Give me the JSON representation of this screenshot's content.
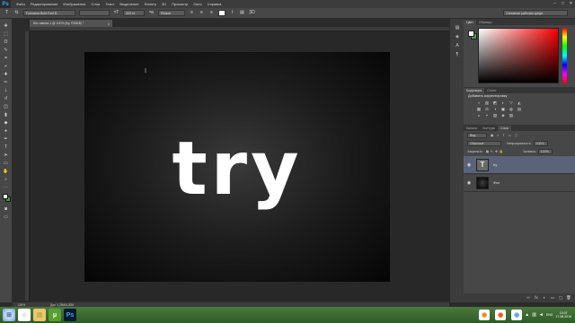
{
  "app": {
    "logo": "Ps",
    "menu": [
      "Файл",
      "Редактирование",
      "Изображение",
      "Слои",
      "Текст",
      "Выделение",
      "Фильтр",
      "3D",
      "Просмотр",
      "Окно",
      "Справка"
    ],
    "window_controls": [
      "–",
      "□",
      "✕"
    ]
  },
  "options": {
    "font_family": "Futurama Bold Font R...",
    "font_style": "",
    "font_size": "300 пт",
    "antialias": "Резкое",
    "workspace": "Основная рабочая среда"
  },
  "document": {
    "tab_title": "Без имени-1 @ 100% (try, RGB/8) *",
    "tab_close": "×",
    "canvas_text": "try",
    "cursor_glyph": "I"
  },
  "status": {
    "zoom": "100%",
    "doc_info": "Док: 3,25М/5,20М"
  },
  "panels": {
    "color_tabs": [
      "Цвет",
      "Образцы"
    ],
    "adjustments_tabs": [
      "Коррекция",
      "Стили"
    ],
    "adjustments_title": "Добавить корректировку",
    "adjustments_row1": [
      "☼",
      "▥",
      "◩",
      "◐",
      "▽",
      "◭"
    ],
    "adjustments_row2": [
      "▦",
      "⚖",
      "◑",
      "▣",
      "◍",
      "▤"
    ],
    "adjustments_row3": [
      "◒",
      "◓",
      "▧",
      "◈",
      "▨"
    ],
    "layers_tabs": [
      "Каналы",
      "Контуры",
      "Слои"
    ],
    "kind_filter": "Вид",
    "blend_mode": "Обычные",
    "opacity_label": "Непрозрачность:",
    "opacity_value": "100%",
    "lock_label": "Закрепить:",
    "fill_label": "Заливка:",
    "fill_value": "100%",
    "layers": [
      {
        "name": "try",
        "type_glyph": "T"
      },
      {
        "name": "Фон",
        "type_glyph": ""
      }
    ],
    "footer_icons": [
      "∞",
      "fx",
      "◐",
      "▭",
      "▢",
      "🗑"
    ]
  },
  "taskbar": {
    "apps": [
      {
        "glyph": "◉",
        "color": "#e9e9e9",
        "bg": "#ffffff"
      },
      {
        "glyph": "▤",
        "color": "#c8a040",
        "bg": "#e8c870"
      },
      {
        "glyph": "μ",
        "color": "#ffffff",
        "bg": "#58a030"
      },
      {
        "glyph": "Ps",
        "color": "#31a8ff",
        "bg": "#0a1a2e"
      }
    ],
    "tray_apps": [
      {
        "glyph": "◉",
        "color": "#ff7a1a",
        "bg": "#ffffff"
      },
      {
        "glyph": "◉",
        "color": "#ff4500",
        "bg": "#ffffff"
      },
      {
        "glyph": "◉",
        "color": "#5aa0e0",
        "bg": "#ffffff"
      }
    ],
    "language": "ENG",
    "time": "13:07",
    "date": "17.08.2016"
  },
  "colors": {
    "foreground": "#ffffff",
    "background": "#4a9a4a",
    "selected_layer": "#5a6378"
  }
}
